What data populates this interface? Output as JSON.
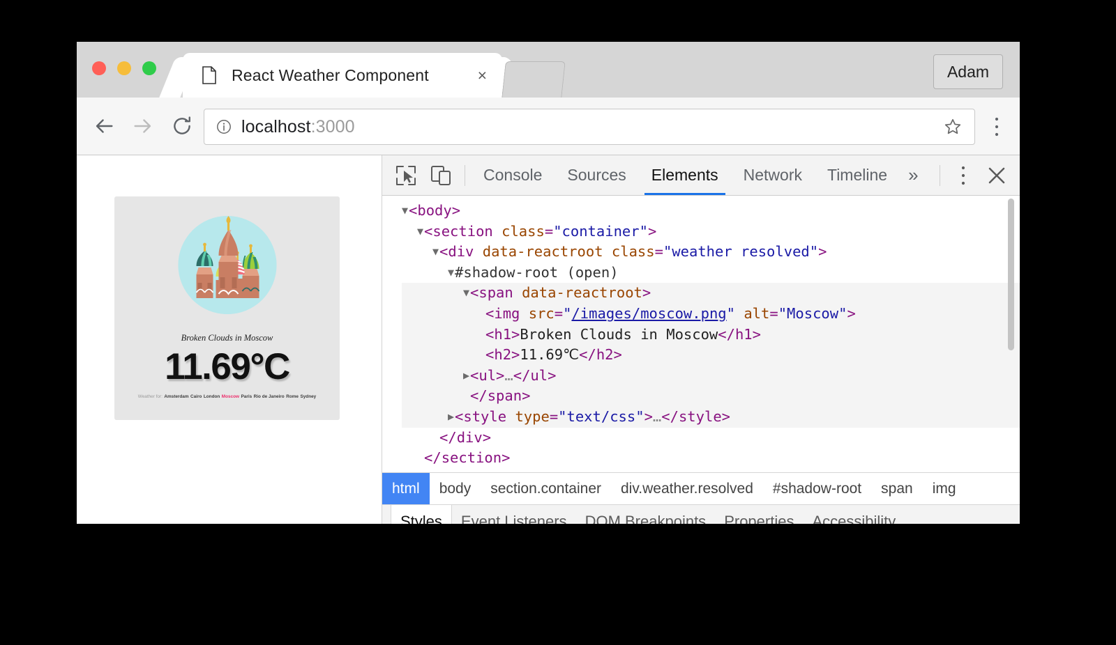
{
  "browser": {
    "tab": {
      "title": "React Weather Component",
      "favicon_icon": "page-icon",
      "close_icon": "×"
    },
    "profile_label": "Adam",
    "omnibox": {
      "info_icon": "info-circle-icon",
      "url_host": "localhost",
      "url_port": ":3000",
      "star_icon": "star-icon"
    },
    "nav": {
      "back_icon": "arrow-left-icon",
      "forward_icon": "arrow-right-icon",
      "reload_icon": "reload-icon",
      "menu_icon": "kebab-menu-icon"
    }
  },
  "page": {
    "weather_card": {
      "image_alt": "Moscow",
      "description": "Broken Clouds in Moscow",
      "temperature": "11.69°C",
      "city_list_label": "Weather for:",
      "cities": [
        "Amsterdam",
        "Cairo",
        "London",
        "Moscow",
        "Paris",
        "Rio de Janeiro",
        "Rome",
        "Sydney"
      ],
      "active_city": "Moscow",
      "active_city_color": "#ec2c6a",
      "card_background": "#e6e6e6",
      "illustration_background": "#b7e8ec"
    }
  },
  "devtools": {
    "toolbar": {
      "inspect_icon": "inspect-cursor-icon",
      "device_icon": "device-toolbar-icon",
      "tabs": [
        "Console",
        "Sources",
        "Elements",
        "Network",
        "Timeline"
      ],
      "selected_tab": "Elements",
      "more_tabs_icon": "»",
      "menu_icon": "kebab-menu-icon",
      "close_icon": "close-icon",
      "accent_color": "#1a73e8"
    },
    "dom_tree": [
      {
        "indent": 0,
        "twisty": "▼",
        "highlight": false,
        "parts": [
          {
            "t": "tag",
            "v": "<body>"
          }
        ]
      },
      {
        "indent": 1,
        "twisty": "▼",
        "highlight": false,
        "parts": [
          {
            "t": "tag",
            "v": "<section "
          },
          {
            "t": "attr",
            "v": "class"
          },
          {
            "t": "tag",
            "v": "="
          },
          {
            "t": "val",
            "v": "\"container\""
          },
          {
            "t": "tag",
            "v": ">"
          }
        ]
      },
      {
        "indent": 2,
        "twisty": "▼",
        "highlight": false,
        "parts": [
          {
            "t": "tag",
            "v": "<div "
          },
          {
            "t": "attr",
            "v": "data-reactroot"
          },
          {
            "t": "tag",
            "v": " "
          },
          {
            "t": "attr",
            "v": "class"
          },
          {
            "t": "tag",
            "v": "="
          },
          {
            "t": "val",
            "v": "\"weather resolved\""
          },
          {
            "t": "tag",
            "v": ">"
          }
        ]
      },
      {
        "indent": 3,
        "twisty": "▼",
        "highlight": false,
        "parts": [
          {
            "t": "shadow",
            "v": "#shadow-root (open)"
          }
        ]
      },
      {
        "indent": 4,
        "twisty": "▼",
        "highlight": true,
        "parts": [
          {
            "t": "tag",
            "v": "<span "
          },
          {
            "t": "attr",
            "v": "data-reactroot"
          },
          {
            "t": "tag",
            "v": ">"
          }
        ]
      },
      {
        "indent": 5,
        "twisty": "",
        "highlight": true,
        "parts": [
          {
            "t": "tag",
            "v": "<img "
          },
          {
            "t": "attr",
            "v": "src"
          },
          {
            "t": "tag",
            "v": "="
          },
          {
            "t": "val",
            "v": "\""
          },
          {
            "t": "lnk",
            "v": "/images/moscow.png"
          },
          {
            "t": "val",
            "v": "\""
          },
          {
            "t": "tag",
            "v": " "
          },
          {
            "t": "attr",
            "v": "alt"
          },
          {
            "t": "tag",
            "v": "="
          },
          {
            "t": "val",
            "v": "\"Moscow\""
          },
          {
            "t": "tag",
            "v": ">"
          }
        ]
      },
      {
        "indent": 5,
        "twisty": "",
        "highlight": true,
        "parts": [
          {
            "t": "tag",
            "v": "<h1>"
          },
          {
            "t": "txt",
            "v": "Broken Clouds in Moscow"
          },
          {
            "t": "tag",
            "v": "</h1>"
          }
        ]
      },
      {
        "indent": 5,
        "twisty": "",
        "highlight": true,
        "parts": [
          {
            "t": "tag",
            "v": "<h2>"
          },
          {
            "t": "txt",
            "v": "11.69℃"
          },
          {
            "t": "tag",
            "v": "</h2>"
          }
        ]
      },
      {
        "indent": 4,
        "twisty": "▶",
        "highlight": true,
        "parts": [
          {
            "t": "tag",
            "v": "<ul>"
          },
          {
            "t": "ell",
            "v": "…"
          },
          {
            "t": "tag",
            "v": "</ul>"
          }
        ]
      },
      {
        "indent": 4,
        "twisty": "",
        "highlight": true,
        "parts": [
          {
            "t": "tag",
            "v": "</span>"
          }
        ]
      },
      {
        "indent": 3,
        "twisty": "▶",
        "highlight": true,
        "parts": [
          {
            "t": "tag",
            "v": "<style "
          },
          {
            "t": "attr",
            "v": "type"
          },
          {
            "t": "tag",
            "v": "="
          },
          {
            "t": "val",
            "v": "\"text/css\""
          },
          {
            "t": "tag",
            "v": ">"
          },
          {
            "t": "ell",
            "v": "…"
          },
          {
            "t": "tag",
            "v": "</style>"
          }
        ]
      },
      {
        "indent": 2,
        "twisty": "",
        "highlight": false,
        "parts": [
          {
            "t": "tag",
            "v": "</div>"
          }
        ]
      },
      {
        "indent": 1,
        "twisty": "",
        "highlight": false,
        "parts": [
          {
            "t": "tag",
            "v": "</section>"
          }
        ]
      }
    ],
    "breadcrumb": {
      "items": [
        "html",
        "body",
        "section.container",
        "div.weather.resolved",
        "#shadow-root",
        "span",
        "img"
      ],
      "selected": "html",
      "selected_color": "#4285f4"
    },
    "sidebar_tabs": {
      "items": [
        "Styles",
        "Event Listeners",
        "DOM Breakpoints",
        "Properties",
        "Accessibility"
      ],
      "selected": "Styles"
    }
  }
}
